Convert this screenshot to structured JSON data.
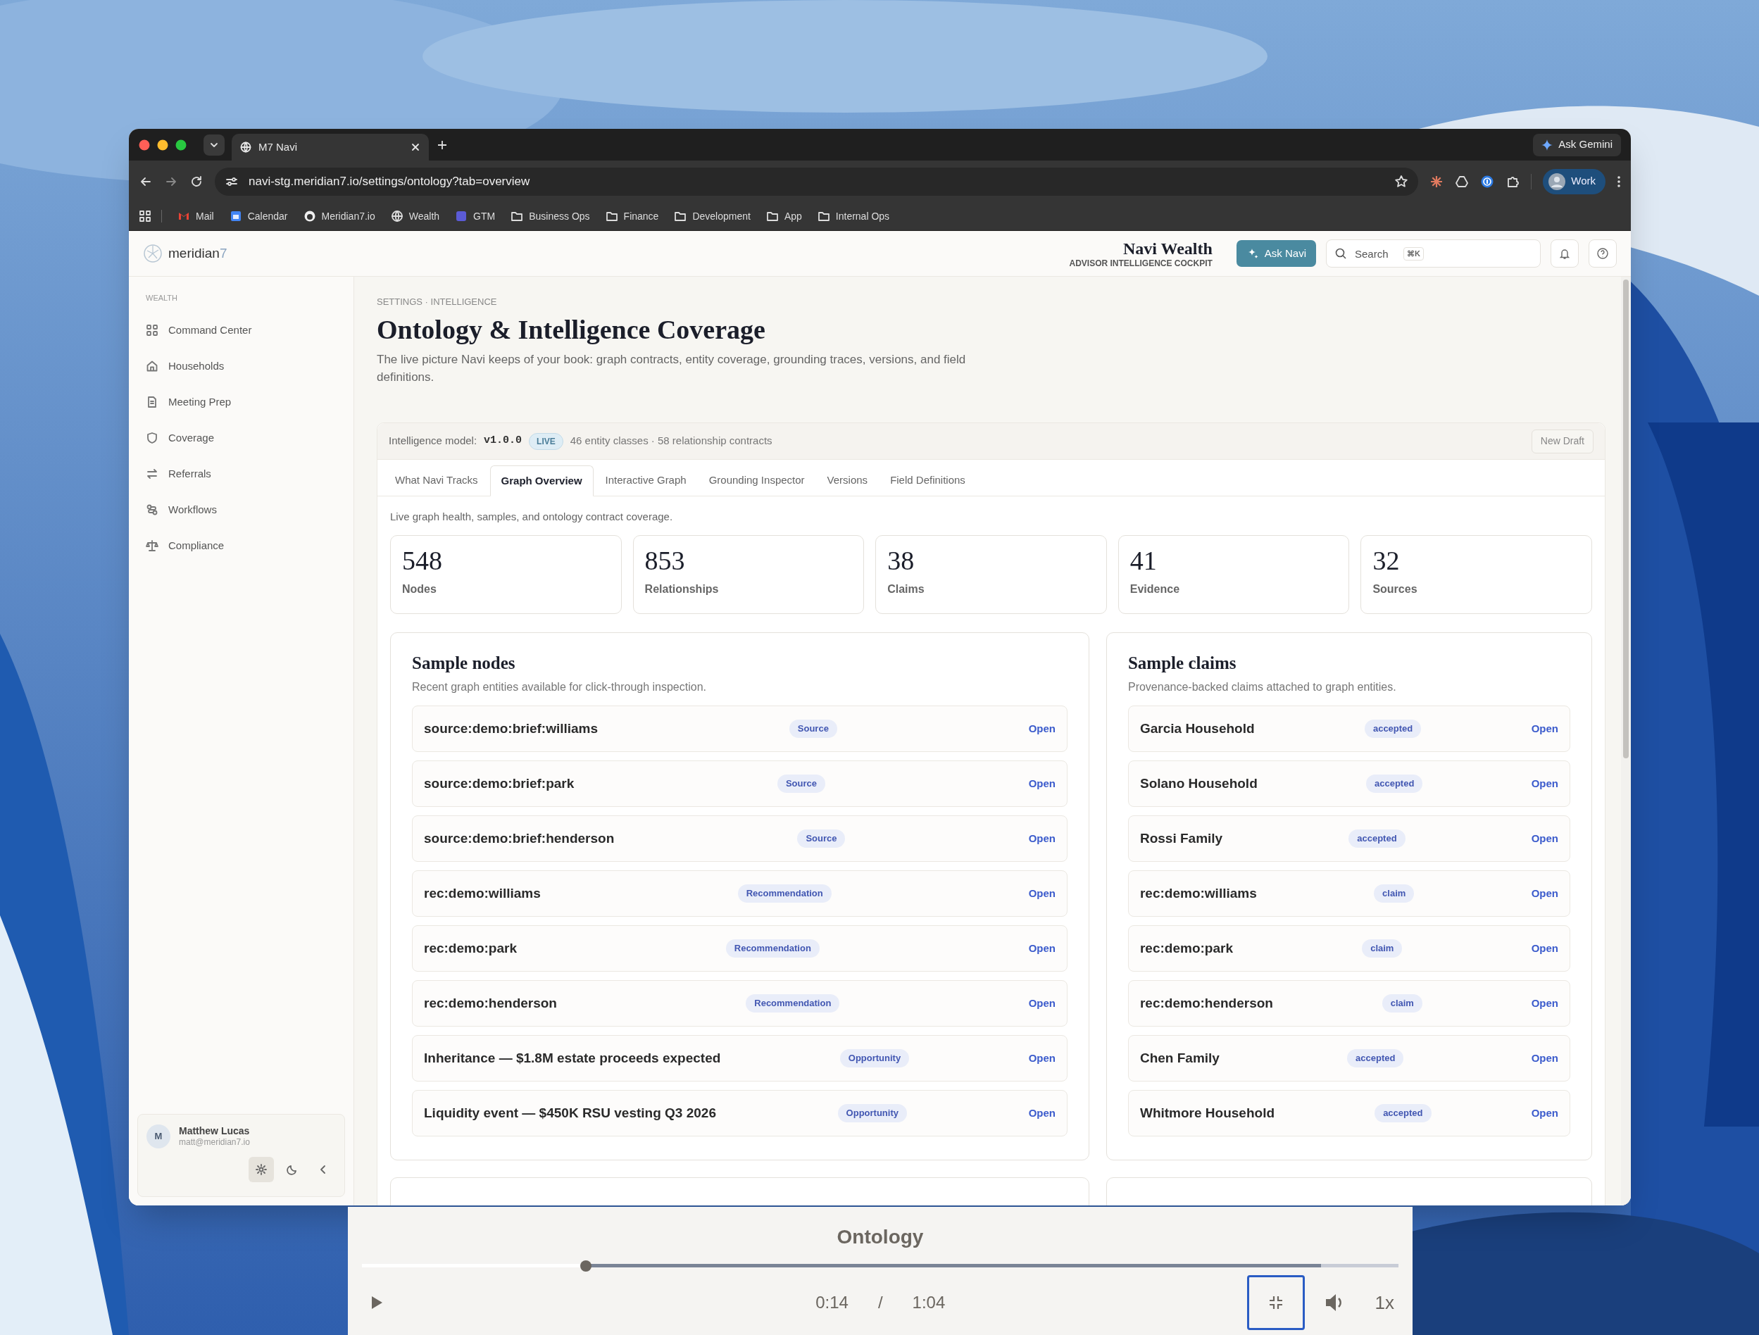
{
  "browser": {
    "tab": {
      "title": "M7 Navi"
    },
    "ask_gemini": "Ask Gemini",
    "url": "navi-stg.meridian7.io/settings/ontology?tab=overview",
    "profile": "Work",
    "bookmarks": [
      {
        "label": "Mail",
        "kind": "mail"
      },
      {
        "label": "Calendar",
        "kind": "calendar"
      },
      {
        "label": "Meridian7.io",
        "kind": "github"
      },
      {
        "label": "Wealth",
        "kind": "globe"
      },
      {
        "label": "GTM",
        "kind": "app"
      },
      {
        "label": "Business Ops",
        "kind": "folder"
      },
      {
        "label": "Finance",
        "kind": "folder"
      },
      {
        "label": "Development",
        "kind": "folder"
      },
      {
        "label": "App",
        "kind": "folder"
      },
      {
        "label": "Internal Ops",
        "kind": "folder"
      }
    ]
  },
  "header": {
    "logo": {
      "name": "meridian",
      "suffix": "7"
    },
    "title": "Navi Wealth",
    "subtitle": "ADVISOR INTELLIGENCE COCKPIT",
    "ask_button": "Ask Navi",
    "search": {
      "placeholder": "Search",
      "shortcut": "⌘K"
    }
  },
  "sidebar": {
    "section": "WEALTH",
    "items": [
      {
        "label": "Command Center",
        "kind": "grid",
        "selected": false
      },
      {
        "label": "Households",
        "kind": "home",
        "selected": false
      },
      {
        "label": "Meeting Prep",
        "kind": "document",
        "selected": false
      },
      {
        "label": "Coverage",
        "kind": "shield",
        "selected": false
      },
      {
        "label": "Referrals",
        "kind": "arrows",
        "selected": false
      },
      {
        "label": "Workflows",
        "kind": "workflow",
        "selected": false
      },
      {
        "label": "Compliance",
        "kind": "scale",
        "selected": false
      }
    ],
    "user": {
      "initial": "M",
      "name": "Matthew Lucas",
      "email": "matt@meridian7.io"
    },
    "footer_buttons": [
      {
        "kind": "settings",
        "selected": true
      },
      {
        "kind": "theme",
        "selected": false
      },
      {
        "kind": "collapse",
        "selected": false
      }
    ]
  },
  "page": {
    "breadcrumb": "SETTINGS · INTELLIGENCE",
    "title": "Ontology & Intelligence Coverage",
    "description": "The live picture Navi keeps of your book: graph contracts, entity coverage, grounding traces, versions, and field definitions."
  },
  "model": {
    "label": "Intelligence model:",
    "version": "v1.0.0",
    "status": "LIVE",
    "summary": "46 entity classes · 58 relationship contracts",
    "button": "New Draft"
  },
  "tabs": [
    {
      "label": "What Navi Tracks",
      "selected": false
    },
    {
      "label": "Graph Overview",
      "selected": true
    },
    {
      "label": "Interactive Graph",
      "selected": false
    },
    {
      "label": "Grounding Inspector",
      "selected": false
    },
    {
      "label": "Versions",
      "selected": false
    },
    {
      "label": "Field Definitions",
      "selected": false
    }
  ],
  "tab_description": "Live graph health, samples, and ontology contract coverage.",
  "stats": [
    {
      "value": "548",
      "label": "Nodes"
    },
    {
      "value": "853",
      "label": "Relationships"
    },
    {
      "value": "38",
      "label": "Claims"
    },
    {
      "value": "41",
      "label": "Evidence"
    },
    {
      "value": "32",
      "label": "Sources"
    }
  ],
  "sample_nodes": {
    "title": "Sample nodes",
    "subtitle": "Recent graph entities available for click-through inspection.",
    "rows": [
      {
        "name": "source:demo:brief:williams",
        "badge": "Source",
        "action": "Open"
      },
      {
        "name": "source:demo:brief:park",
        "badge": "Source",
        "action": "Open"
      },
      {
        "name": "source:demo:brief:henderson",
        "badge": "Source",
        "action": "Open"
      },
      {
        "name": "rec:demo:williams",
        "badge": "Recommendation",
        "action": "Open"
      },
      {
        "name": "rec:demo:park",
        "badge": "Recommendation",
        "action": "Open"
      },
      {
        "name": "rec:demo:henderson",
        "badge": "Recommendation",
        "action": "Open"
      },
      {
        "name": "Inheritance — $1.8M estate proceeds expected",
        "badge": "Opportunity",
        "action": "Open"
      },
      {
        "name": "Liquidity event — $450K RSU vesting Q3 2026",
        "badge": "Opportunity",
        "action": "Open"
      }
    ]
  },
  "sample_claims": {
    "title": "Sample claims",
    "subtitle": "Provenance-backed claims attached to graph entities.",
    "rows": [
      {
        "name": "Garcia Household",
        "badge": "accepted",
        "action": "Open"
      },
      {
        "name": "Solano Household",
        "badge": "accepted",
        "action": "Open"
      },
      {
        "name": "Rossi Family",
        "badge": "accepted",
        "action": "Open"
      },
      {
        "name": "rec:demo:williams",
        "badge": "claim",
        "action": "Open"
      },
      {
        "name": "rec:demo:park",
        "badge": "claim",
        "action": "Open"
      },
      {
        "name": "rec:demo:henderson",
        "badge": "claim",
        "action": "Open"
      },
      {
        "name": "Chen Family",
        "badge": "accepted",
        "action": "Open"
      },
      {
        "name": "Whitmore Household",
        "badge": "accepted",
        "action": "Open"
      }
    ]
  },
  "player": {
    "title": "Ontology",
    "progress": {
      "level": 0.216
    },
    "buffer": {
      "level": 0.925
    },
    "current": "0:14",
    "separator": "/",
    "duration": "1:04",
    "speed": "1x",
    "fullscreen_button": {
      "focused": true
    }
  }
}
